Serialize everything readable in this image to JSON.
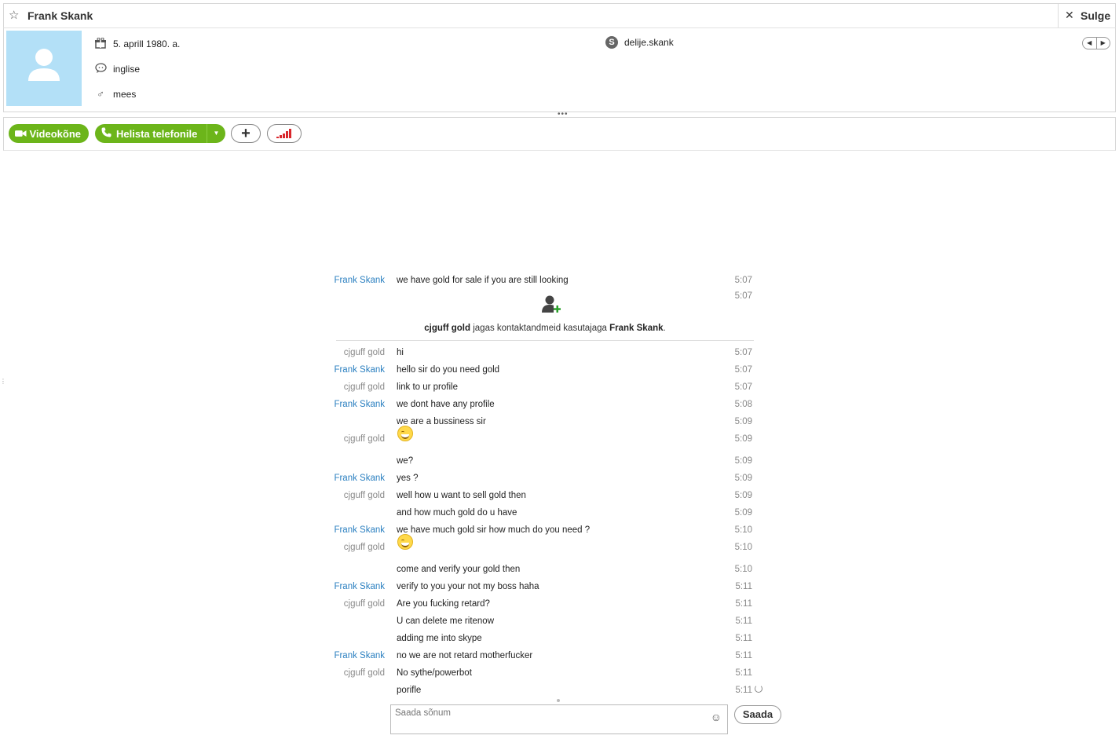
{
  "window": {
    "title": "Frank Skank",
    "close_label": "Sulge"
  },
  "profile": {
    "birthday": "5. aprill 1980. a.",
    "language": "inglise",
    "gender": "mees",
    "skype_name": "delije.skank"
  },
  "toolbar": {
    "video_label": "Videokõne",
    "call_label": "Helista telefonile"
  },
  "colors": {
    "accent_green": "#6cb51a",
    "frank_name": "#2a7fc0",
    "cj_name": "#8a8a8a"
  },
  "contact_share": {
    "sender": "cjguff gold",
    "middle": " jagas kontaktandmeid kasutajaga ",
    "receiver": "Frank Skank",
    "end": ".",
    "time": "5:07"
  },
  "messages": [
    {
      "sender": "Frank Skank",
      "who": "frank",
      "text": "we have gold for sale if you are still looking",
      "time": "5:07"
    },
    {
      "sender": "cjguff gold",
      "who": "cj",
      "text": "hi",
      "time": "5:07"
    },
    {
      "sender": "Frank Skank",
      "who": "frank",
      "text": "hello sir do you need gold",
      "time": "5:07"
    },
    {
      "sender": "cjguff gold",
      "who": "cj",
      "text": "link to ur profile",
      "time": "5:07"
    },
    {
      "sender": "Frank Skank",
      "who": "frank",
      "text": "we dont have any profile",
      "time": "5:08"
    },
    {
      "sender": "",
      "who": "frank",
      "text": "we are a bussiness sir",
      "time": "5:09"
    },
    {
      "sender": "cjguff gold",
      "who": "cj",
      "text": "",
      "emoji": true,
      "time": "5:09"
    },
    {
      "sender": "",
      "who": "cj",
      "text": "we?",
      "time": "5:09"
    },
    {
      "sender": "Frank Skank",
      "who": "frank",
      "text": "yes ?",
      "time": "5:09"
    },
    {
      "sender": "cjguff gold",
      "who": "cj",
      "text": "well how u want to sell gold then",
      "time": "5:09"
    },
    {
      "sender": "",
      "who": "cj",
      "text": "and how much gold do u have",
      "time": "5:09"
    },
    {
      "sender": "Frank Skank",
      "who": "frank",
      "text": "we have much gold sir how much do you need ?",
      "time": "5:10"
    },
    {
      "sender": "cjguff gold",
      "who": "cj",
      "text": "",
      "emoji": true,
      "time": "5:10"
    },
    {
      "sender": "",
      "who": "cj",
      "text": "come and verify your gold then",
      "time": "5:10"
    },
    {
      "sender": "Frank Skank",
      "who": "frank",
      "text": "verify to you your not my boss haha",
      "time": "5:11"
    },
    {
      "sender": "cjguff gold",
      "who": "cj",
      "text": "Are you fucking retard?",
      "time": "5:11"
    },
    {
      "sender": "",
      "who": "cj",
      "text": "U can delete me ritenow",
      "time": "5:11"
    },
    {
      "sender": "",
      "who": "cj",
      "text": "adding me into skype",
      "time": "5:11"
    },
    {
      "sender": "Frank Skank",
      "who": "frank",
      "text": "no we are not retard motherfucker",
      "time": "5:11"
    },
    {
      "sender": "cjguff gold",
      "who": "cj",
      "text": "No sythe/powerbot",
      "time": "5:11"
    },
    {
      "sender": "",
      "who": "cj",
      "text": "porifle",
      "time": "5:11"
    }
  ],
  "composer": {
    "placeholder": "Saada sõnum",
    "send_label": "Saada"
  }
}
